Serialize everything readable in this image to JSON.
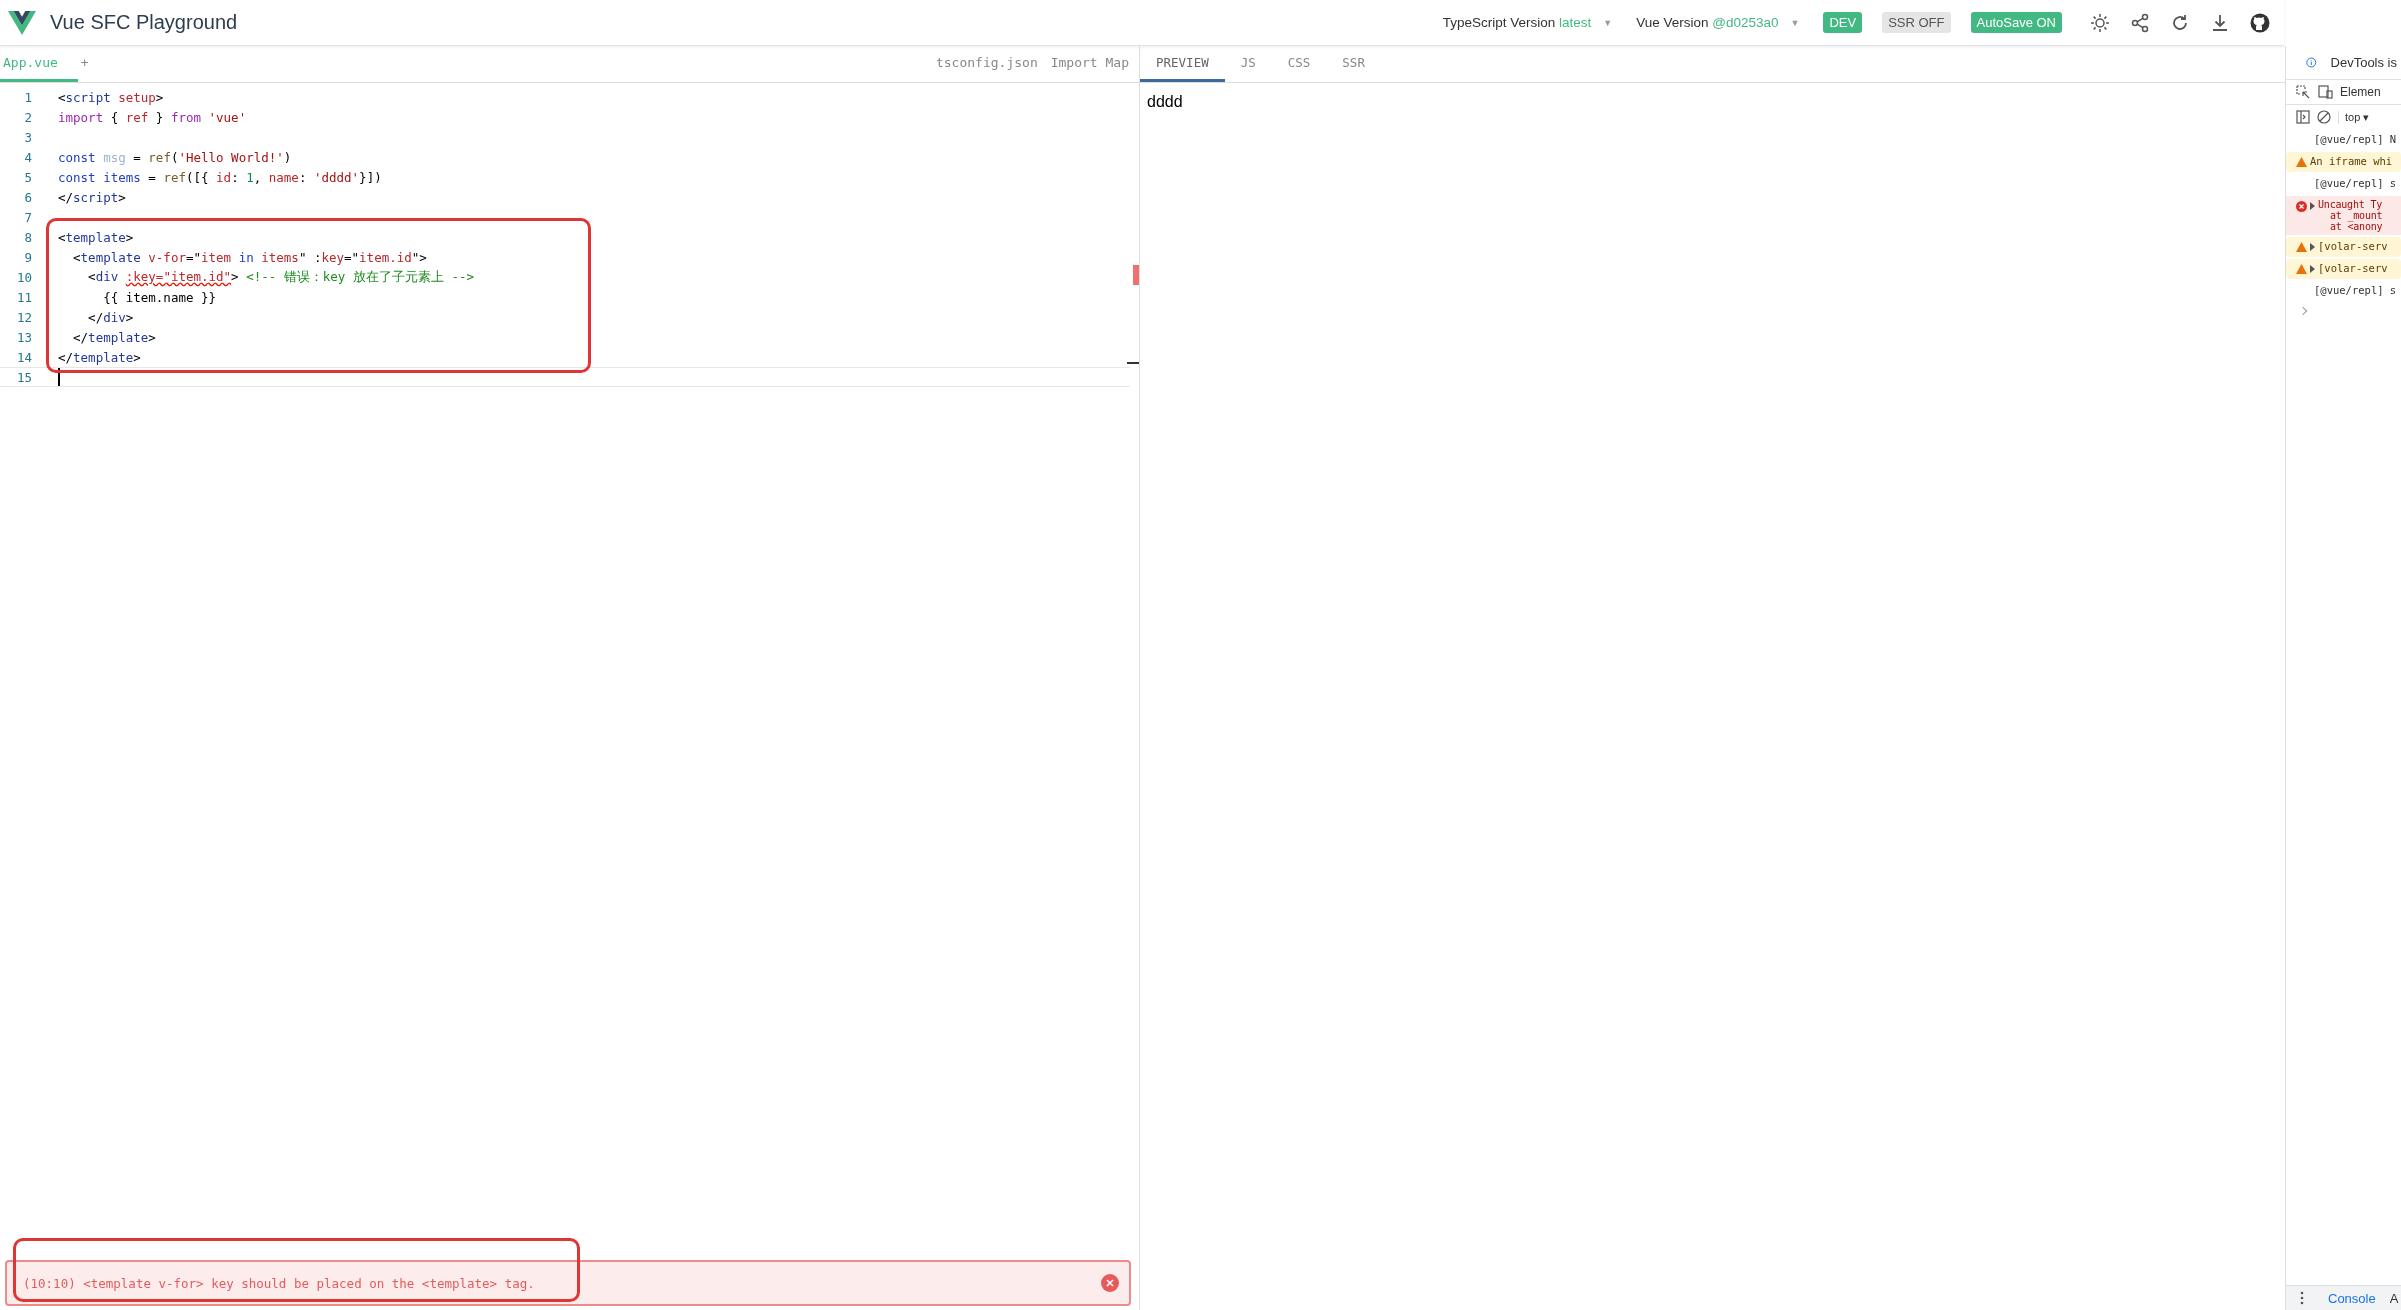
{
  "header": {
    "title": "Vue SFC Playground",
    "ts_label": "TypeScript Version",
    "ts_value": "latest",
    "ts_caret": "▼",
    "vue_label": "Vue Version",
    "vue_value": "@d0253a0",
    "vue_caret": "▼",
    "badges": [
      {
        "label": "DEV",
        "on": true
      },
      {
        "label": "SSR OFF",
        "on": false
      },
      {
        "label": "AutoSave ON",
        "on": true
      }
    ]
  },
  "file_tabs": [
    {
      "label": "App.vue",
      "selected": true
    },
    {
      "label": "+",
      "selected": false
    },
    {
      "label": "tsconfig.json",
      "selected": false
    },
    {
      "label": "Import Map",
      "selected": false
    }
  ],
  "output_tabs": [
    {
      "label": "PREVIEW",
      "selected": true
    },
    {
      "label": "JS",
      "selected": false
    },
    {
      "label": "CSS",
      "selected": false
    },
    {
      "label": "SSR",
      "selected": false
    }
  ],
  "code": [
    {
      "num": "1",
      "tokens": [
        {
          "t": "<"
        },
        {
          "t": "script",
          "color": "#22379a"
        },
        {
          "t": " setup",
          "color": "#b7272c"
        },
        {
          "t": ">"
        }
      ]
    },
    {
      "num": "2",
      "tokens": [
        {
          "t": "import",
          "color": "#9c27b0"
        },
        {
          "t": " { "
        },
        {
          "t": "ref",
          "color": "#b7272c"
        },
        {
          "t": " } "
        },
        {
          "t": "from",
          "color": "#9c27b0"
        },
        {
          "t": " 'vue'",
          "color": "#a31515"
        }
      ]
    },
    {
      "num": "3"
    },
    {
      "num": "4",
      "tokens": [
        {
          "t": "const",
          "color": "#1f3fbf"
        },
        {
          "t": " msg",
          "color": "#9fb4cc"
        },
        {
          "t": " = "
        },
        {
          "t": "ref",
          "color": "#795e26"
        },
        {
          "t": "("
        },
        {
          "t": "'Hello World!'",
          "color": "#a31515"
        },
        {
          "t": ")"
        }
      ]
    },
    {
      "num": "5",
      "tokens": [
        {
          "t": "const",
          "color": "#1f3fbf"
        },
        {
          "t": " items",
          "color": "#1f3fbf"
        },
        {
          "t": " = "
        },
        {
          "t": "ref",
          "color": "#795e26"
        },
        {
          "t": "([{ "
        },
        {
          "t": "id",
          "color": "#b7272c"
        },
        {
          "t": ": "
        },
        {
          "t": "1",
          "color": "#098658"
        },
        {
          "t": ", "
        },
        {
          "t": "name",
          "color": "#b7272c"
        },
        {
          "t": ": "
        },
        {
          "t": "'dddd'",
          "color": "#a31515"
        },
        {
          "t": "}])"
        }
      ]
    },
    {
      "num": "6",
      "tokens": [
        {
          "t": "</"
        },
        {
          "t": "script",
          "color": "#22379a"
        },
        {
          "t": ">"
        }
      ]
    },
    {
      "num": "7"
    },
    {
      "num": "8",
      "tokens": [
        {
          "t": "<"
        },
        {
          "t": "template",
          "color": "#22379a"
        },
        {
          "t": ">"
        }
      ]
    },
    {
      "num": "9",
      "tokens": [
        {
          "t": "  <"
        },
        {
          "t": "template",
          "color": "#22379a"
        },
        {
          "t": " v-for",
          "color": "#b7272c"
        },
        {
          "t": "=\""
        },
        {
          "t": "item",
          "color": "#b7272c"
        },
        {
          "t": " in ",
          "color": "#1f3fbf"
        },
        {
          "t": "items",
          "color": "#b7272c"
        },
        {
          "t": "\" :"
        },
        {
          "t": "key",
          "color": "#b7272c"
        },
        {
          "t": "=\""
        },
        {
          "t": "item.id",
          "color": "#b7272c"
        },
        {
          "t": "\">"
        }
      ]
    },
    {
      "num": "10",
      "tokens": [
        {
          "t": "    <"
        },
        {
          "t": "div ",
          "color": "#22379a"
        },
        {
          "t": ":key=\"item.id\"",
          "color": "#b7272c",
          "error": true
        },
        {
          "t": "> "
        },
        {
          "t": "<!-- 错误：key 放在了子元素上 -->",
          "color": "#1f8a1f"
        }
      ]
    },
    {
      "num": "11",
      "tokens": [
        {
          "t": "      {{ item.name }}"
        }
      ]
    },
    {
      "num": "12",
      "tokens": [
        {
          "t": "    </"
        },
        {
          "t": "div",
          "color": "#22379a"
        },
        {
          "t": ">"
        }
      ]
    },
    {
      "num": "13",
      "tokens": [
        {
          "t": "  </"
        },
        {
          "t": "template",
          "color": "#22379a"
        },
        {
          "t": ">"
        }
      ]
    },
    {
      "num": "14",
      "tokens": [
        {
          "t": "</"
        },
        {
          "t": "template",
          "color": "#22379a"
        },
        {
          "t": ">"
        }
      ]
    },
    {
      "num": "15",
      "cursor": true
    }
  ],
  "error_message": "(10:10) <template v-for> key should be placed on the <template> tag.",
  "preview_text": "dddd",
  "devtools": {
    "notice": "DevTools is",
    "tab": "Elemen",
    "context": "top ▾",
    "entries": [
      {
        "kind": "log",
        "expandable": false,
        "lines": [
          "[@vue/repl] N"
        ]
      },
      {
        "kind": "warning",
        "expandable": false,
        "lines": [
          "An iframe whi"
        ]
      },
      {
        "kind": "log",
        "expandable": false,
        "lines": [
          "[@vue/repl] s"
        ]
      },
      {
        "kind": "error",
        "expandable": true,
        "lines": [
          "Uncaught Ty",
          "at _mount",
          "at <anony"
        ]
      },
      {
        "kind": "warning",
        "expandable": true,
        "lines": [
          "[volar-serv"
        ]
      },
      {
        "kind": "warning",
        "expandable": true,
        "lines": [
          "[volar-serv"
        ]
      },
      {
        "kind": "log",
        "expandable": false,
        "lines": [
          "[@vue/repl] s"
        ]
      }
    ],
    "drawer_tabs": [
      "Console",
      "A"
    ]
  },
  "annotations": {
    "code_frame": true,
    "error_frame": true
  }
}
